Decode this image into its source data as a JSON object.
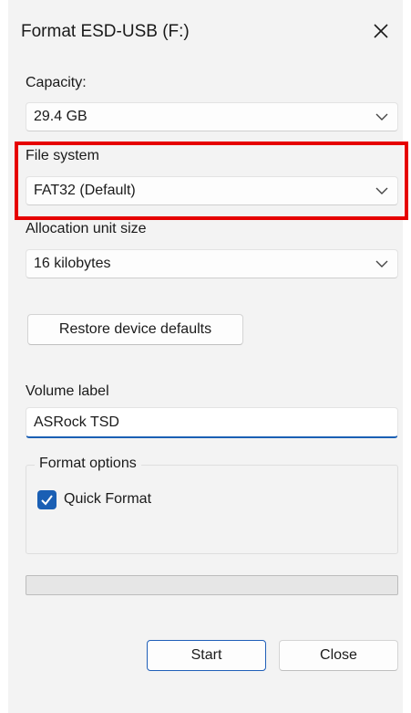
{
  "window": {
    "title": "Format ESD-USB (F:)"
  },
  "capacity": {
    "label": "Capacity:",
    "value": "29.4 GB"
  },
  "file_system": {
    "label": "File system",
    "value": "FAT32 (Default)"
  },
  "allocation": {
    "label": "Allocation unit size",
    "value": "16 kilobytes"
  },
  "buttons": {
    "restore": "Restore device defaults",
    "start": "Start",
    "close": "Close"
  },
  "volume": {
    "label": "Volume label",
    "value": "ASRock TSD"
  },
  "format_options": {
    "title": "Format options",
    "quick_format_label": "Quick Format",
    "quick_format_checked": true
  },
  "progress": {
    "fraction": 0
  },
  "colors": {
    "accent": "#1a5fb4",
    "highlight": "#e60000"
  }
}
